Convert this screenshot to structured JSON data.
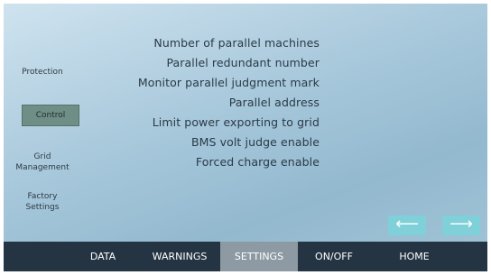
{
  "sidebar": {
    "items": [
      {
        "label": "Protection"
      },
      {
        "label": "Control",
        "active": true
      },
      {
        "label": "Grid Management",
        "line1": "Grid",
        "line2": "Management"
      },
      {
        "label": "Factory Settings",
        "line1": "Factory",
        "line2": "Settings"
      }
    ]
  },
  "settings": {
    "items": [
      "Number of parallel machines",
      "Parallel redundant number",
      "Monitor parallel judgment mark",
      "Parallel address",
      "Limit power exporting to grid",
      "BMS volt judge enable",
      "Forced charge enable"
    ]
  },
  "arrows": {
    "left": "⟵",
    "right": "⟶",
    "color": "#7fd0d8"
  },
  "nav": {
    "items": [
      "DATA",
      "WARNINGS",
      "SETTINGS",
      "ON/OFF",
      "HOME"
    ],
    "active": "SETTINGS",
    "bar_color": "#243443",
    "active_color": "#8d9aa3"
  }
}
